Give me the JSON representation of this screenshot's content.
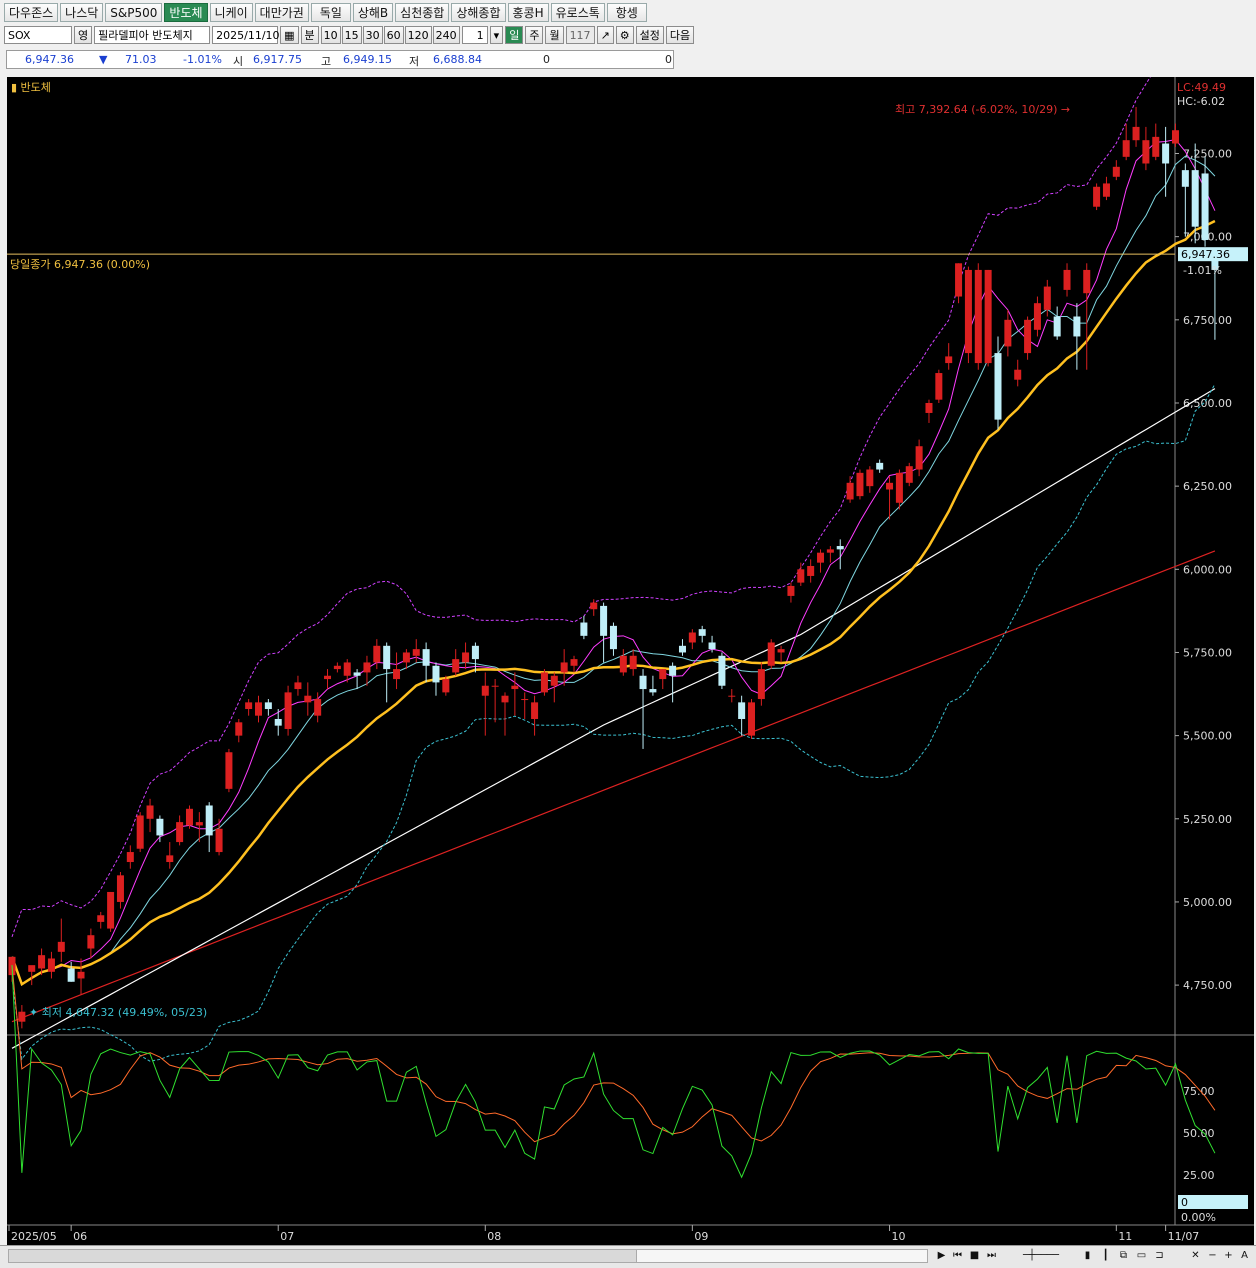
{
  "tabs": [
    "다우존스",
    "나스닥",
    "S&P500",
    "반도체",
    "니케이",
    "대만가권",
    "독일",
    "상해B",
    "심천종합",
    "상해종합",
    "홍콩H",
    "유로스톡",
    "항셍"
  ],
  "active_tab": 3,
  "toolbar": {
    "symbol": "SOX",
    "exchange": "영",
    "name": "필라델피아 반도체지",
    "date": "2025/11/10",
    "minute": "분",
    "intervals": [
      "10",
      "15",
      "30",
      "60",
      "120",
      "240"
    ],
    "count": "1",
    "day": "일",
    "week": "주",
    "month": "월",
    "bars": "117",
    "settings": "설정",
    "next": "다음"
  },
  "quote": {
    "price": "6,947.36",
    "arrow": "▼",
    "change": "71.03",
    "pct": "-1.01%",
    "open_label": "시",
    "open": "6,917.75",
    "high_label": "고",
    "high": "6,949.15",
    "low_label": "저",
    "low": "6,688.84",
    "v1": "0",
    "v2": "0"
  },
  "chart_data": {
    "type": "candlestick",
    "title": "반도체",
    "ylim": [
      4600,
      7480
    ],
    "y_ticks": [
      4750,
      5000,
      5250,
      5500,
      5750,
      6000,
      6250,
      6500,
      6750,
      7000,
      7250
    ],
    "y_tick_labels": [
      "4,750.00",
      "5,000.00",
      "5,250.00",
      "5,500.00",
      "5,750.00",
      "6,000.00",
      "6,250.00",
      "6,500.00",
      "6,750.00",
      "7,000.00",
      "7,250.00"
    ],
    "x_labels": [
      {
        "index": 0,
        "text": "2025/05"
      },
      {
        "index": 6,
        "text": "06"
      },
      {
        "index": 27,
        "text": "07"
      },
      {
        "index": 48,
        "text": "08"
      },
      {
        "index": 69,
        "text": "09"
      },
      {
        "index": 89,
        "text": "10"
      },
      {
        "index": 112,
        "text": "11"
      },
      {
        "index": 117,
        "text": "11/07"
      }
    ],
    "candles": [
      [
        4780,
        4835,
        4760,
        4810
      ],
      [
        4640,
        4670,
        4620,
        4690
      ],
      [
        4790,
        4810,
        4750,
        4800
      ],
      [
        4800,
        4840,
        4780,
        4860
      ],
      [
        4790,
        4830,
        4770,
        4850
      ],
      [
        4850,
        4880,
        4820,
        4950
      ],
      [
        4800,
        4760,
        4760,
        4820
      ],
      [
        4770,
        4790,
        4720,
        4830
      ],
      [
        4860,
        4900,
        4830,
        4920
      ],
      [
        4940,
        4960,
        4920,
        4970
      ],
      [
        4920,
        5030,
        4910,
        5030
      ],
      [
        5000,
        5080,
        4980,
        5090
      ],
      [
        5120,
        5150,
        5100,
        5170
      ],
      [
        5160,
        5260,
        5150,
        5270
      ],
      [
        5250,
        5290,
        5210,
        5310
      ],
      [
        5250,
        5200,
        5180,
        5260
      ],
      [
        5120,
        5140,
        5100,
        5180
      ],
      [
        5180,
        5240,
        5170,
        5260
      ],
      [
        5230,
        5280,
        5220,
        5290
      ],
      [
        5230,
        5240,
        5180,
        5270
      ],
      [
        5290,
        5200,
        5150,
        5300
      ],
      [
        5150,
        5220,
        5140,
        5250
      ],
      [
        5340,
        5450,
        5330,
        5460
      ],
      [
        5500,
        5540,
        5480,
        5550
      ],
      [
        5580,
        5600,
        5560,
        5610
      ],
      [
        5560,
        5600,
        5540,
        5620
      ],
      [
        5600,
        5580,
        5560,
        5610
      ],
      [
        5550,
        5530,
        5500,
        5580
      ],
      [
        5520,
        5630,
        5500,
        5650
      ],
      [
        5640,
        5660,
        5620,
        5680
      ],
      [
        5600,
        5620,
        5560,
        5660
      ],
      [
        5560,
        5610,
        5540,
        5630
      ],
      [
        5670,
        5680,
        5640,
        5700
      ],
      [
        5700,
        5710,
        5690,
        5720
      ],
      [
        5680,
        5720,
        5660,
        5730
      ],
      [
        5690,
        5680,
        5640,
        5700
      ],
      [
        5690,
        5720,
        5650,
        5740
      ],
      [
        5720,
        5770,
        5700,
        5790
      ],
      [
        5770,
        5700,
        5600,
        5780
      ],
      [
        5670,
        5700,
        5640,
        5750
      ],
      [
        5720,
        5750,
        5700,
        5760
      ],
      [
        5740,
        5760,
        5720,
        5790
      ],
      [
        5760,
        5710,
        5660,
        5780
      ],
      [
        5710,
        5660,
        5620,
        5720
      ],
      [
        5630,
        5670,
        5620,
        5680
      ],
      [
        5690,
        5730,
        5680,
        5760
      ],
      [
        5720,
        5750,
        5700,
        5780
      ],
      [
        5770,
        5730,
        5690,
        5780
      ],
      [
        5620,
        5650,
        5500,
        5690
      ],
      [
        5650,
        5650,
        5540,
        5670
      ],
      [
        5600,
        5620,
        5500,
        5630
      ],
      [
        5640,
        5650,
        5560,
        5690
      ],
      [
        5610,
        5610,
        5550,
        5630
      ],
      [
        5550,
        5600,
        5500,
        5620
      ],
      [
        5630,
        5690,
        5620,
        5700
      ],
      [
        5650,
        5680,
        5600,
        5690
      ],
      [
        5690,
        5720,
        5650,
        5760
      ],
      [
        5710,
        5730,
        5690,
        5740
      ],
      [
        5840,
        5800,
        5790,
        5860
      ],
      [
        5880,
        5900,
        5860,
        5910
      ],
      [
        5890,
        5800,
        5720,
        5900
      ],
      [
        5830,
        5760,
        5740,
        5840
      ],
      [
        5690,
        5740,
        5680,
        5760
      ],
      [
        5700,
        5740,
        5680,
        5760
      ],
      [
        5680,
        5640,
        5460,
        5700
      ],
      [
        5640,
        5630,
        5620,
        5680
      ],
      [
        5670,
        5700,
        5640,
        5700
      ],
      [
        5710,
        5680,
        5600,
        5720
      ],
      [
        5770,
        5750,
        5740,
        5790
      ],
      [
        5780,
        5810,
        5760,
        5820
      ],
      [
        5820,
        5800,
        5780,
        5830
      ],
      [
        5780,
        5760,
        5750,
        5800
      ],
      [
        5740,
        5650,
        5640,
        5750
      ],
      [
        5620,
        5620,
        5600,
        5640
      ],
      [
        5600,
        5550,
        5500,
        5620
      ],
      [
        5500,
        5600,
        5490,
        5610
      ],
      [
        5610,
        5700,
        5590,
        5720
      ],
      [
        5710,
        5780,
        5700,
        5790
      ],
      [
        5750,
        5760,
        5720,
        5770
      ],
      [
        5920,
        5950,
        5900,
        5960
      ],
      [
        5960,
        6000,
        5950,
        6020
      ],
      [
        5980,
        6010,
        5960,
        6030
      ],
      [
        6020,
        6050,
        5990,
        6060
      ],
      [
        6050,
        6060,
        6020,
        6070
      ],
      [
        6070,
        6060,
        6000,
        6090
      ],
      [
        6210,
        6260,
        6200,
        6280
      ],
      [
        6220,
        6290,
        6210,
        6300
      ],
      [
        6250,
        6300,
        6230,
        6310
      ],
      [
        6320,
        6300,
        6290,
        6330
      ],
      [
        6240,
        6260,
        6150,
        6280
      ],
      [
        6200,
        6290,
        6180,
        6300
      ],
      [
        6260,
        6310,
        6250,
        6320
      ],
      [
        6300,
        6370,
        6280,
        6390
      ],
      [
        6470,
        6500,
        6440,
        6510
      ],
      [
        6510,
        6590,
        6500,
        6600
      ],
      [
        6620,
        6640,
        6600,
        6680
      ],
      [
        6820,
        6920,
        6800,
        6920
      ],
      [
        6650,
        6900,
        6620,
        6910
      ],
      [
        6620,
        6900,
        6600,
        6920
      ],
      [
        6620,
        6900,
        6610,
        6900
      ],
      [
        6650,
        6450,
        6420,
        6700
      ],
      [
        6670,
        6750,
        6640,
        6780
      ],
      [
        6570,
        6600,
        6550,
        6630
      ],
      [
        6650,
        6750,
        6630,
        6760
      ],
      [
        6720,
        6800,
        6700,
        6820
      ],
      [
        6780,
        6850,
        6760,
        6870
      ],
      [
        6760,
        6700,
        6690,
        6790
      ],
      [
        6840,
        6900,
        6820,
        6920
      ],
      [
        6760,
        6700,
        6600,
        6800
      ],
      [
        6830,
        6900,
        6600,
        6920
      ],
      [
        7090,
        7150,
        7080,
        7160
      ],
      [
        7120,
        7160,
        7110,
        7180
      ],
      [
        7180,
        7210,
        7170,
        7230
      ],
      [
        7240,
        7290,
        7230,
        7340
      ],
      [
        7290,
        7330,
        7270,
        7390
      ],
      [
        7220,
        7290,
        7200,
        7330
      ],
      [
        7240,
        7300,
        7230,
        7340
      ],
      [
        7280,
        7220,
        7120,
        7330
      ],
      [
        7280,
        7320,
        7270,
        7340
      ],
      [
        7200,
        7150,
        7000,
        7220
      ],
      [
        7200,
        7030,
        6980,
        7280
      ],
      [
        7190,
        6990,
        6970,
        7240
      ],
      [
        6947,
        6900,
        6690,
        6950
      ]
    ],
    "indicator": {
      "y_tick_labels": [
        "75.00",
        "50.00",
        "25.00"
      ],
      "value_box": "0",
      "bottom_label": "0.00%"
    },
    "annotations": {
      "high_label": "최고 7,392.64 (-6.02%, 10/29)",
      "low_label": "최저 4,647.32 (49.49%, 05/23)",
      "close_label": "당일종가 6,947.36 (0.00%)",
      "last_price_box": "6,947.36",
      "last_change": "-1.01%",
      "lc": "LC:49.49",
      "hc": "HC:-6.02",
      "close_value": 6947.36
    },
    "colors": {
      "up": "#dc2020",
      "down": "#bfeef8",
      "ma5": "#ff3cff",
      "ma10": "#7fd6e0",
      "ma20": "#ffc020",
      "ma60": "#ffffff",
      "ma120": "#dd2222",
      "bb": "#d040ff",
      "bb_low": "#3bc0d0"
    }
  }
}
